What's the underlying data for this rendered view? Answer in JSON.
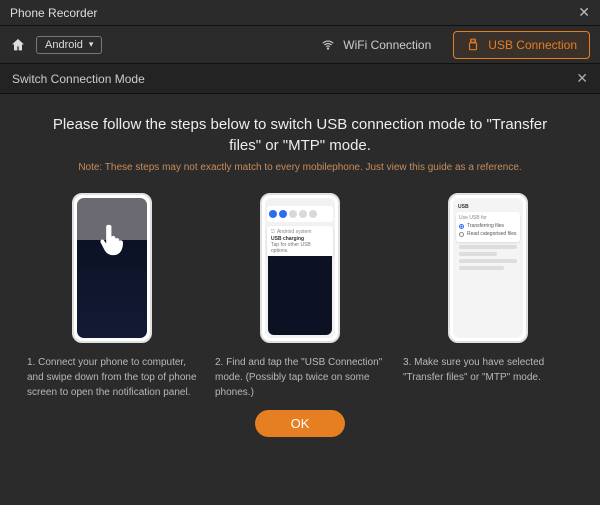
{
  "app": {
    "title": "Phone Recorder"
  },
  "toolbar": {
    "platform": "Android",
    "wifi_label": "WiFi Connection",
    "usb_label": "USB Connection"
  },
  "section": {
    "title": "Switch Connection Mode"
  },
  "modal": {
    "title": "Please follow the steps below to switch USB connection mode to \"Transfer files\" or \"MTP\" mode.",
    "note": "Note: These steps may not exactly match to every mobilephone. Just view this guide as a reference.",
    "ok_label": "OK"
  },
  "steps": [
    {
      "text": "1. Connect your phone to computer, and swipe down from the top of phone screen to open the notification panel."
    },
    {
      "text": "2. Find and tap the \"USB Connection\" mode. (Possibly tap twice on some phones.)"
    },
    {
      "text": "3. Make sure you have selected \"Transfer files\" or \"MTP\" mode."
    }
  ],
  "mock": {
    "step2": {
      "source": "Android system",
      "title": "USB charging",
      "sub": "Tap for other USB options."
    },
    "step3": {
      "heading": "USB",
      "group": "Use USB for",
      "opt1": "Transferring files",
      "opt2": "Read categorised files"
    }
  }
}
